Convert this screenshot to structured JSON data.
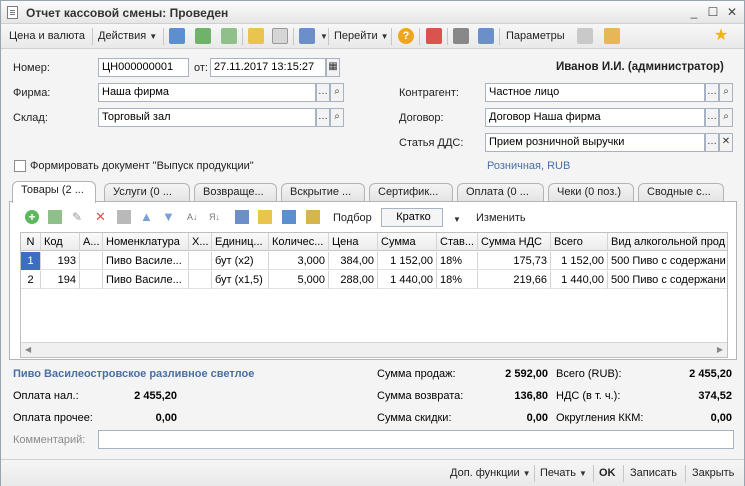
{
  "window": {
    "title": "Отчет кассовой смены: Проведен",
    "controls": {
      "minimize": "_",
      "maximize": "☐",
      "close": "✕"
    }
  },
  "toolbar": {
    "price_currency": "Цена и валюта",
    "actions": "Действия",
    "goto": "Перейти",
    "params": "Параметры"
  },
  "header": {
    "number_label": "Номер:",
    "number_value": "ЦН000000001",
    "date_label": "от:",
    "date_value": "27.11.2017 13:15:27",
    "user": "Иванов И.И. (администратор)",
    "firm_label": "Фирма:",
    "firm_value": "Наша фирма",
    "warehouse_label": "Склад:",
    "warehouse_value": "Торговый зал",
    "contractor_label": "Контрагент:",
    "contractor_value": "Частное лицо",
    "contract_label": "Договор:",
    "contract_value": "Договор Наша фирма",
    "dds_label": "Статья ДДС:",
    "dds_value": "Прием розничной выручки",
    "produce_checkbox": "Формировать документ \"Выпуск продукции\"",
    "price_type": "Розничная, RUB"
  },
  "tabs": [
    {
      "label": "Товары (2 ...",
      "active": true
    },
    {
      "label": "Услуги (0 ...",
      "active": false
    },
    {
      "label": "Возвраще...",
      "active": false
    },
    {
      "label": "Вскрытие ...",
      "active": false
    },
    {
      "label": "Сертифик...",
      "active": false
    },
    {
      "label": "Оплата (0 ...",
      "active": false
    },
    {
      "label": "Чеки (0 поз.)",
      "active": false
    },
    {
      "label": "Сводные с...",
      "active": false
    }
  ],
  "table_toolbar": {
    "pick": "Подбор",
    "mode": "Кратко",
    "change": "Изменить"
  },
  "grid": {
    "columns": [
      "N",
      "Код",
      "А...",
      "Номенклатура",
      "Х...",
      "Единиц...",
      "Количес...",
      "Цена",
      "Сумма",
      "Став...",
      "Сумма НДС",
      "Всего",
      "Вид алкогольной прод"
    ],
    "rows": [
      [
        "1",
        "193",
        "",
        "Пиво Василе...",
        "",
        "бут (x2)",
        "3,000",
        "384,00",
        "1 152,00",
        "18%",
        "175,73",
        "1 152,00",
        "500 Пиво с содержани"
      ],
      [
        "2",
        "194",
        "",
        "Пиво Василе...",
        "",
        "бут (x1,5)",
        "5,000",
        "288,00",
        "1 440,00",
        "18%",
        "219,66",
        "1 440,00",
        "500 Пиво с содержани"
      ]
    ]
  },
  "totals": {
    "item_name": "Пиво Василеостровское разливное светлое",
    "sales_label": "Сумма продаж:",
    "sales_value": "2 592,00",
    "total_label": "Всего (RUB):",
    "total_value": "2 455,20",
    "cash_label": "Оплата нал.:",
    "cash_value": "2 455,20",
    "return_label": "Сумма возврата:",
    "return_value": "136,80",
    "vat_label": "НДС (в т. ч.):",
    "vat_value": "374,52",
    "other_label": "Оплата прочее:",
    "other_value": "0,00",
    "discount_label": "Сумма скидки:",
    "discount_value": "0,00",
    "rounding_label": "Округления ККМ:",
    "rounding_value": "0,00",
    "comment_label": "Комментарий:"
  },
  "footer": {
    "extra": "Доп. функции",
    "print": "Печать",
    "ok": "OK",
    "save": "Записать",
    "close": "Закрыть"
  },
  "colors": {
    "accent": "#3e6ec2",
    "link": "#4a6fa5"
  }
}
